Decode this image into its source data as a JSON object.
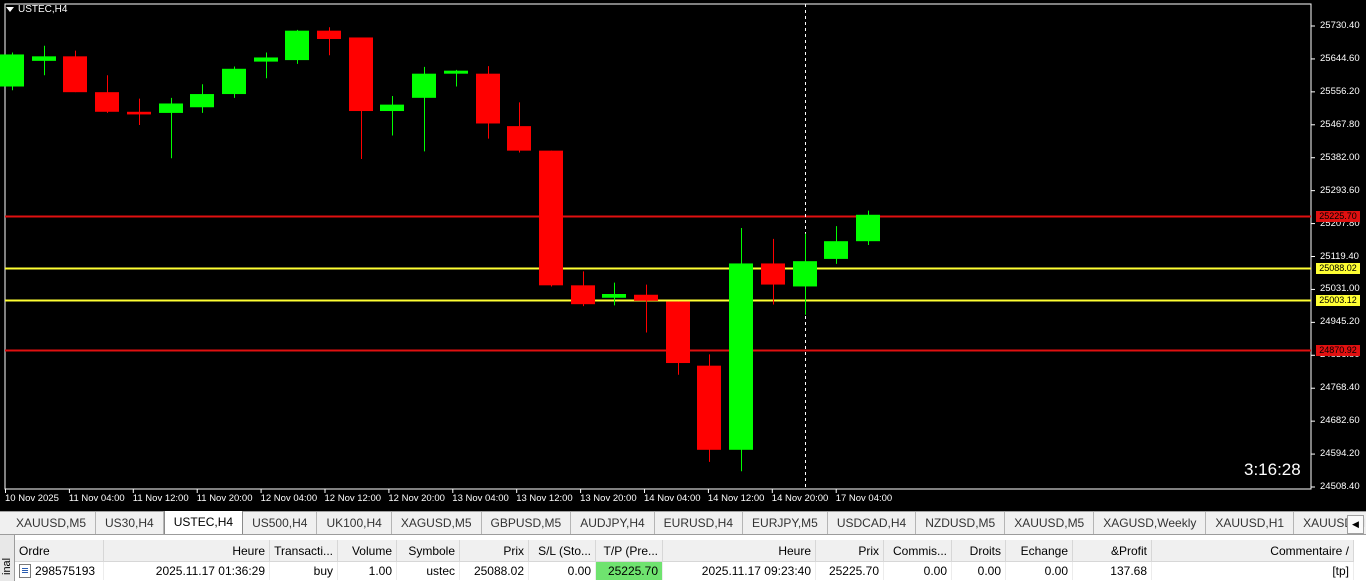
{
  "chart": {
    "symbol": "USTEC,H4",
    "countdown": "3:16:28",
    "price_ticks": [
      "25730.40",
      "25644.60",
      "25556.20",
      "25467.80",
      "25382.00",
      "25293.60",
      "25207.80",
      "25119.40",
      "25031.00",
      "24945.20",
      "24856.80",
      "24768.40",
      "24682.60",
      "24594.20",
      "24508.40"
    ],
    "date_ticks": [
      "10 Nov 2025",
      "11 Nov 04:00",
      "11 Nov 12:00",
      "11 Nov 20:00",
      "12 Nov 04:00",
      "12 Nov 12:00",
      "12 Nov 20:00",
      "13 Nov 04:00",
      "13 Nov 12:00",
      "13 Nov 20:00",
      "14 Nov 04:00",
      "14 Nov 12:00",
      "14 Nov 20:00",
      "17 Nov 04:00"
    ],
    "levels": [
      {
        "value": "25225.70",
        "line_color": "#e01010",
        "label_bg": "#e01010",
        "label_color": "#000000"
      },
      {
        "value": "25088.02",
        "line_color": "#ffff33",
        "label_bg": "#ffff33",
        "label_color": "#000000"
      },
      {
        "value": "25003.12",
        "line_color": "#ffff33",
        "label_bg": "#ffff33",
        "label_color": "#000000"
      },
      {
        "value": "24870.92",
        "line_color": "#e01010",
        "label_bg": "#e01010",
        "label_color": "#000000"
      }
    ],
    "colors": {
      "bull": "#00ff00",
      "bear": "#ff0000",
      "background": "#000000",
      "text": "#ffffff",
      "crosshair": "#ffffff"
    }
  },
  "chart_data": {
    "type": "candlestick",
    "instrument": "USTEC",
    "timeframe": "H4",
    "ylim": [
      24508.4,
      25730.4
    ],
    "candles": [
      {
        "o": 25570,
        "h": 25660,
        "l": 25560,
        "c": 25655
      },
      {
        "o": 25638,
        "h": 25678,
        "l": 25600,
        "c": 25650
      },
      {
        "o": 25650,
        "h": 25665,
        "l": 25555,
        "c": 25555
      },
      {
        "o": 25555,
        "h": 25600,
        "l": 25500,
        "c": 25503
      },
      {
        "o": 25503,
        "h": 25538,
        "l": 25468,
        "c": 25496
      },
      {
        "o": 25500,
        "h": 25540,
        "l": 25380,
        "c": 25525
      },
      {
        "o": 25515,
        "h": 25576,
        "l": 25500,
        "c": 25550
      },
      {
        "o": 25550,
        "h": 25623,
        "l": 25540,
        "c": 25617
      },
      {
        "o": 25636,
        "h": 25660,
        "l": 25592,
        "c": 25647
      },
      {
        "o": 25640,
        "h": 25720,
        "l": 25630,
        "c": 25718
      },
      {
        "o": 25718,
        "h": 25727,
        "l": 25653,
        "c": 25696
      },
      {
        "o": 25700,
        "h": 25700,
        "l": 25378,
        "c": 25505
      },
      {
        "o": 25505,
        "h": 25545,
        "l": 25440,
        "c": 25522
      },
      {
        "o": 25540,
        "h": 25622,
        "l": 25398,
        "c": 25604
      },
      {
        "o": 25604,
        "h": 25614,
        "l": 25570,
        "c": 25612
      },
      {
        "o": 25604,
        "h": 25624,
        "l": 25432,
        "c": 25472
      },
      {
        "o": 25465,
        "h": 25528,
        "l": 25395,
        "c": 25400
      },
      {
        "o": 25400,
        "h": 25400,
        "l": 25040,
        "c": 25043
      },
      {
        "o": 25043,
        "h": 25080,
        "l": 24988,
        "c": 24993
      },
      {
        "o": 25010,
        "h": 25050,
        "l": 24990,
        "c": 25020
      },
      {
        "o": 25018,
        "h": 25045,
        "l": 24918,
        "c": 25002
      },
      {
        "o": 25000,
        "h": 25000,
        "l": 24806,
        "c": 24837
      },
      {
        "o": 24830,
        "h": 24860,
        "l": 24575,
        "c": 24607
      },
      {
        "o": 24607,
        "h": 25195,
        "l": 24550,
        "c": 25101
      },
      {
        "o": 25101,
        "h": 25166,
        "l": 24992,
        "c": 25045
      },
      {
        "o": 25040,
        "h": 25180,
        "l": 24965,
        "c": 25107
      },
      {
        "o": 25113,
        "h": 25200,
        "l": 25100,
        "c": 25160
      },
      {
        "o": 25160,
        "h": 25241,
        "l": 25150,
        "c": 25230
      }
    ]
  },
  "tabs": [
    "XAUUSD,M5",
    "US30,H4",
    "USTEC,H4",
    "US500,H4",
    "UK100,H4",
    "XAGUSD,M5",
    "GBPUSD,M5",
    "AUDJPY,H4",
    "EURUSD,H4",
    "EURJPY,M5",
    "USDCAD,H4",
    "NZDUSD,M5",
    "XAUUSD,M5",
    "XAGUSD,Weekly",
    "XAUUSD,H1",
    "XAUUSD,H"
  ],
  "active_tab": 2,
  "terminal": {
    "side_label": "inal",
    "headers": [
      "Ordre",
      "Heure",
      "Transacti...",
      "Volume",
      "Symbole",
      "Prix",
      "S/L (Sto...",
      "T/P (Pre...",
      "Heure",
      "Prix",
      "Commis...",
      "Droits",
      "Echange",
      "&Profit",
      "Commentaire"
    ],
    "header_suffix": "/",
    "row": [
      "298575193",
      "2025.11.17 01:36:29",
      "buy",
      "1.00",
      "ustec",
      "25088.02",
      "0.00",
      "25225.70",
      "2025.11.17 09:23:40",
      "25225.70",
      "0.00",
      "0.00",
      "0.00",
      "137.68",
      "[tp]"
    ]
  }
}
